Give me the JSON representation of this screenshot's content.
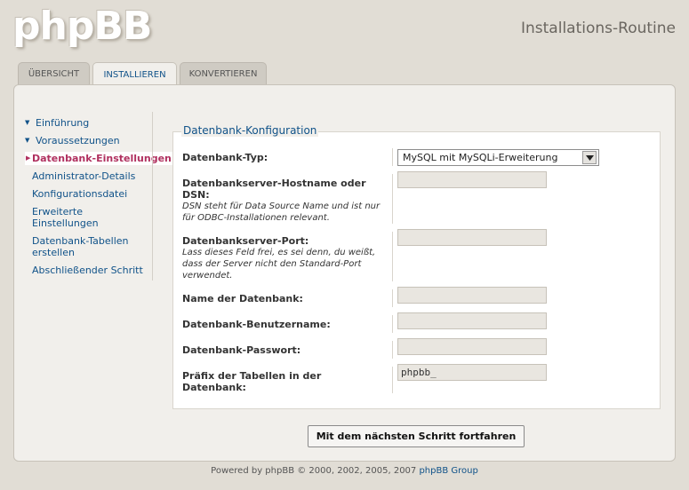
{
  "header": {
    "logo_text": "phpBB",
    "site_title": "Installations-Routine"
  },
  "tabs": [
    {
      "label": "ÜBERSICHT",
      "active": false
    },
    {
      "label": "INSTALLIEREN",
      "active": true
    },
    {
      "label": "KONVERTIEREN",
      "active": false
    }
  ],
  "sidebar": {
    "items": [
      {
        "label": "Einführung",
        "state": "done"
      },
      {
        "label": "Voraussetzungen",
        "state": "done"
      },
      {
        "label": "Datenbank-Einstellungen",
        "state": "active"
      },
      {
        "label": "Administrator-Details",
        "state": "todo"
      },
      {
        "label": "Konfigurationsdatei",
        "state": "todo"
      },
      {
        "label": "Erweiterte Einstellungen",
        "state": "todo"
      },
      {
        "label": "Datenbank-Tabellen erstellen",
        "state": "todo"
      },
      {
        "label": "Abschließender Schritt",
        "state": "todo"
      }
    ]
  },
  "form": {
    "legend": "Datenbank-Konfiguration",
    "db_type": {
      "label": "Datenbank-Typ:",
      "selected": "MySQL mit MySQLi-Erweiterung"
    },
    "db_host": {
      "label": "Datenbankserver-Hostname oder DSN:",
      "help": "DSN steht für Data Source Name und ist nur für ODBC-Installationen relevant.",
      "value": ""
    },
    "db_port": {
      "label": "Datenbankserver-Port:",
      "help": "Lass dieses Feld frei, es sei denn, du weißt, dass der Server nicht den Standard-Port verwendet.",
      "value": ""
    },
    "db_name": {
      "label": "Name der Datenbank:",
      "value": ""
    },
    "db_user": {
      "label": "Datenbank-Benutzername:",
      "value": ""
    },
    "db_pass": {
      "label": "Datenbank-Passwort:",
      "value": ""
    },
    "table_prefix": {
      "label": "Präfix der Tabellen in der Datenbank:",
      "value": "phpbb_"
    },
    "submit_label": "Mit dem nächsten Schritt fortfahren"
  },
  "footer": {
    "text": "Powered by phpBB © 2000, 2002, 2005, 2007 ",
    "link": "phpBB Group"
  },
  "colors": {
    "background": "#e1ddd5",
    "panel": "#f1efeb",
    "link": "#105289",
    "active_menu": "#b0305f"
  },
  "icons": {
    "done_marker": "chevron-down-icon",
    "active_marker": "chevron-right-icon",
    "select_arrow": "chevron-down-icon"
  }
}
